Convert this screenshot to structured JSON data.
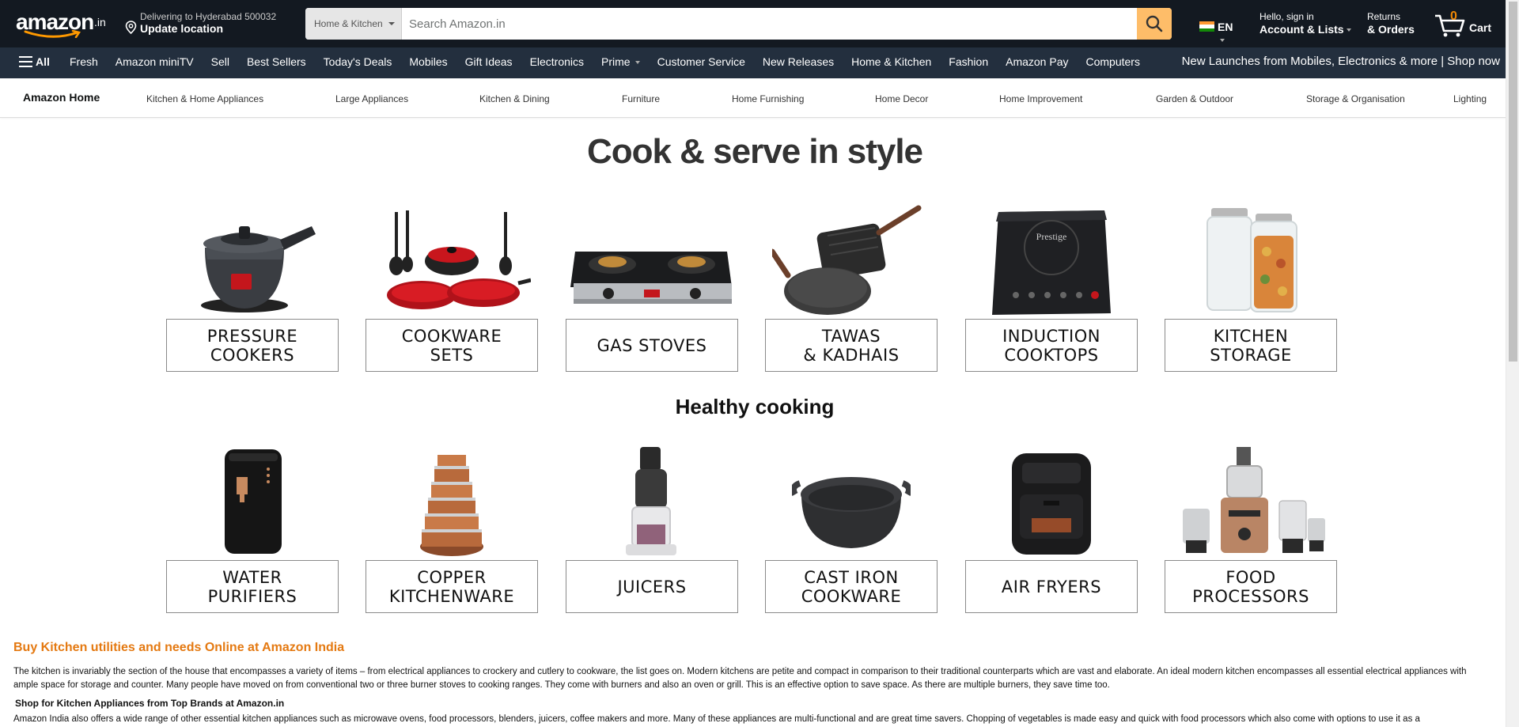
{
  "header": {
    "logo_text": "amazon",
    "logo_suffix": ".in",
    "deliver_line1": "Delivering to Hyderabad 500032",
    "deliver_line2": "Update location",
    "search_category": "Home & Kitchen",
    "search_placeholder": "Search Amazon.in",
    "language": "EN",
    "account_line1": "Hello, sign in",
    "account_line2": "Account & Lists",
    "returns_line1": "Returns",
    "returns_line2": "& Orders",
    "cart_count": "0",
    "cart_label": "Cart"
  },
  "nav": {
    "all_label": "All",
    "items": [
      "Fresh",
      "Amazon miniTV",
      "Sell",
      "Best Sellers",
      "Today's Deals",
      "Mobiles",
      "Gift Ideas",
      "Electronics",
      "Prime",
      "Customer Service",
      "New Releases",
      "Home & Kitchen",
      "Fashion",
      "Amazon Pay",
      "Computers"
    ],
    "promo": "New Launches from Mobiles, Electronics & more | Shop now"
  },
  "subnav": {
    "title": "Amazon Home",
    "items": [
      "Kitchen & Home Appliances",
      "Large Appliances",
      "Kitchen & Dining",
      "Furniture",
      "Home Furnishing",
      "Home Decor",
      "Home Improvement",
      "Garden & Outdoor",
      "Storage & Organisation",
      "Lighting"
    ]
  },
  "section1": {
    "heading": "Cook & serve in style",
    "tiles": [
      {
        "label": "PRESSURE\nCOOKERS",
        "icon": "pressure-cooker"
      },
      {
        "label": "COOKWARE\nSETS",
        "icon": "cookware-set"
      },
      {
        "label": "GAS STOVES",
        "icon": "gas-stove"
      },
      {
        "label": "TAWAS\n& KADHAIS",
        "icon": "tawa"
      },
      {
        "label": "INDUCTION\nCOOKTOPS",
        "icon": "induction-cooktop"
      },
      {
        "label": "KITCHEN\nSTORAGE",
        "icon": "storage-jars"
      }
    ]
  },
  "section2": {
    "heading": "Healthy cooking",
    "tiles": [
      {
        "label": "WATER\nPURIFIERS",
        "icon": "water-purifier"
      },
      {
        "label": "COPPER\nKITCHENWARE",
        "icon": "copper-pots"
      },
      {
        "label": "JUICERS",
        "icon": "juicer"
      },
      {
        "label": "CAST IRON\nCOOKWARE",
        "icon": "cast-iron-kadai"
      },
      {
        "label": "AIR FRYERS",
        "icon": "air-fryer"
      },
      {
        "label": "FOOD\nPROCESSORS",
        "icon": "food-processor"
      }
    ]
  },
  "seo": {
    "title": "Buy Kitchen utilities and needs Online at Amazon India",
    "paragraph1": "The kitchen is invariably the section of the house that encompasses a variety of items – from electrical appliances to crockery and cutlery to cookware, the list goes on. Modern kitchens are petite and compact in comparison to their traditional counterparts which are vast and elaborate. An ideal modern kitchen encompasses all essential electrical appliances with ample space for storage and counter. Many people have moved on from conventional two or three burner stoves to cooking ranges. They come with burners and also an oven or grill. This is an effective option to save space. As there are multiple burners, they save time too.",
    "subheading": "Shop for Kitchen Appliances from Top Brands at Amazon.in",
    "paragraph2": "Amazon India also offers a wide range of other essential kitchen appliances such as microwave ovens, food processors, blenders, juicers, coffee makers and more. Many of these appliances are multi-functional and are great time savers. Chopping of vegetables is made easy and quick with food processors which also come with options to use it as a"
  },
  "colors": {
    "header_bg": "#131921",
    "nav_bg": "#232f3e",
    "search_button": "#febd69",
    "cart_count": "#f08804",
    "seo_title": "#e47911"
  }
}
